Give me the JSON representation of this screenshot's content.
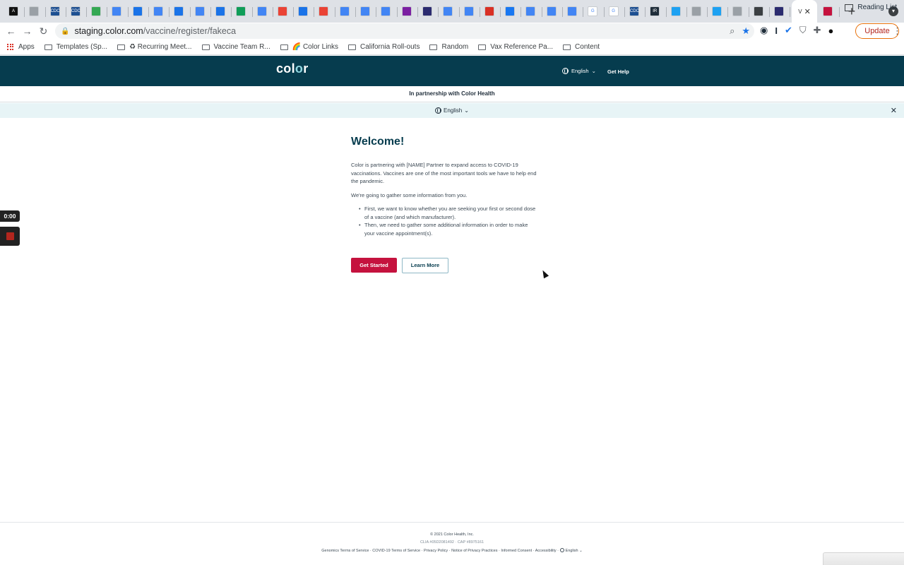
{
  "browser": {
    "tabs": [
      {
        "glyph": "A",
        "color": "#111111"
      },
      {
        "glyph": "",
        "color": "#9aa0a6"
      },
      {
        "glyph": "CDC",
        "color": "#1d4f91"
      },
      {
        "glyph": "CDC",
        "color": "#1d4f91"
      },
      {
        "glyph": "",
        "color": "#34a853"
      },
      {
        "glyph": "",
        "color": "#4285f4"
      },
      {
        "glyph": "",
        "color": "#1a73e8"
      },
      {
        "glyph": "",
        "color": "#4285f4"
      },
      {
        "glyph": "",
        "color": "#1a73e8"
      },
      {
        "glyph": "",
        "color": "#4285f4"
      },
      {
        "glyph": "",
        "color": "#1a73e8"
      },
      {
        "glyph": "",
        "color": "#0f9d58"
      },
      {
        "glyph": "",
        "color": "#4285f4"
      },
      {
        "glyph": "",
        "color": "#ea4335"
      },
      {
        "glyph": "",
        "color": "#1a73e8"
      },
      {
        "glyph": "",
        "color": "#ea4335"
      },
      {
        "glyph": "",
        "color": "#4285f4"
      },
      {
        "glyph": "",
        "color": "#4285f4"
      },
      {
        "glyph": "",
        "color": "#4285f4"
      },
      {
        "glyph": "",
        "color": "#7b1fa2"
      },
      {
        "glyph": "",
        "color": "#2b2b6f"
      },
      {
        "glyph": "",
        "color": "#4285f4"
      },
      {
        "glyph": "",
        "color": "#4285f4"
      },
      {
        "glyph": "",
        "color": "#d93025"
      },
      {
        "glyph": "",
        "color": "#1877f2"
      },
      {
        "glyph": "",
        "color": "#4285f4"
      },
      {
        "glyph": "",
        "color": "#4285f4"
      },
      {
        "glyph": "",
        "color": "#4285f4"
      },
      {
        "glyph": "G",
        "color": "#ffffff"
      },
      {
        "glyph": "G",
        "color": "#ffffff"
      },
      {
        "glyph": "CDC",
        "color": "#1d4f91"
      },
      {
        "glyph": "IR",
        "color": "#1f2d3a"
      },
      {
        "glyph": "",
        "color": "#1da1f2"
      },
      {
        "glyph": "",
        "color": "#9aa0a6"
      },
      {
        "glyph": "",
        "color": "#1da1f2"
      },
      {
        "glyph": "",
        "color": "#9aa0a6"
      },
      {
        "glyph": "",
        "color": "#3c4043"
      },
      {
        "glyph": "",
        "color": "#2b2b6f"
      },
      {
        "glyph": "",
        "color": "#c5123e"
      }
    ],
    "active_tab_glyph": "V",
    "url_host": "staging.color.com",
    "url_path": "/vaccine/register/fakeca",
    "update_label": "Update",
    "bookmarks": [
      "Apps",
      "Templates (Sp...",
      "♻ Recurring Meet...",
      "Vaccine Team R...",
      "🌈 Color Links",
      "California Roll-outs",
      "Random",
      "Vax Reference Pa...",
      "Content"
    ],
    "reading_list": "Reading List"
  },
  "site": {
    "logo_a": "col",
    "logo_b": "o",
    "logo_c": "r",
    "language": "English",
    "get_help": "Get Help",
    "partnership": "In partnership with Color Health",
    "lang_bar": "English"
  },
  "main": {
    "title": "Welcome!",
    "intro": "Color is partnering with [NAME] Partner to expand access to COVID-19 vaccinations. Vaccines are one of the most important tools we have to help end the pandemic.",
    "gather": "We're going to gather some information from you.",
    "bullets": [
      "First, we want to know whether you are seeking your first or second dose of a vaccine (and which manufacturer).",
      "Then, we need to gather some additional information in order to make your vaccine appointment(s)."
    ],
    "get_started": "Get Started",
    "learn_more": "Learn More"
  },
  "recorder": {
    "time": "0:00"
  },
  "footer": {
    "copyright": "© 2021 Color Health, Inc.",
    "clia": "CLIA #05D2081492 · CAP #8975161",
    "links": [
      "Genomics Terms of Service",
      "COVID-19 Terms of Service",
      "Privacy Policy",
      "Notice of Privacy Practices",
      "Informed Consent",
      "Accessibility"
    ],
    "language": "English"
  }
}
